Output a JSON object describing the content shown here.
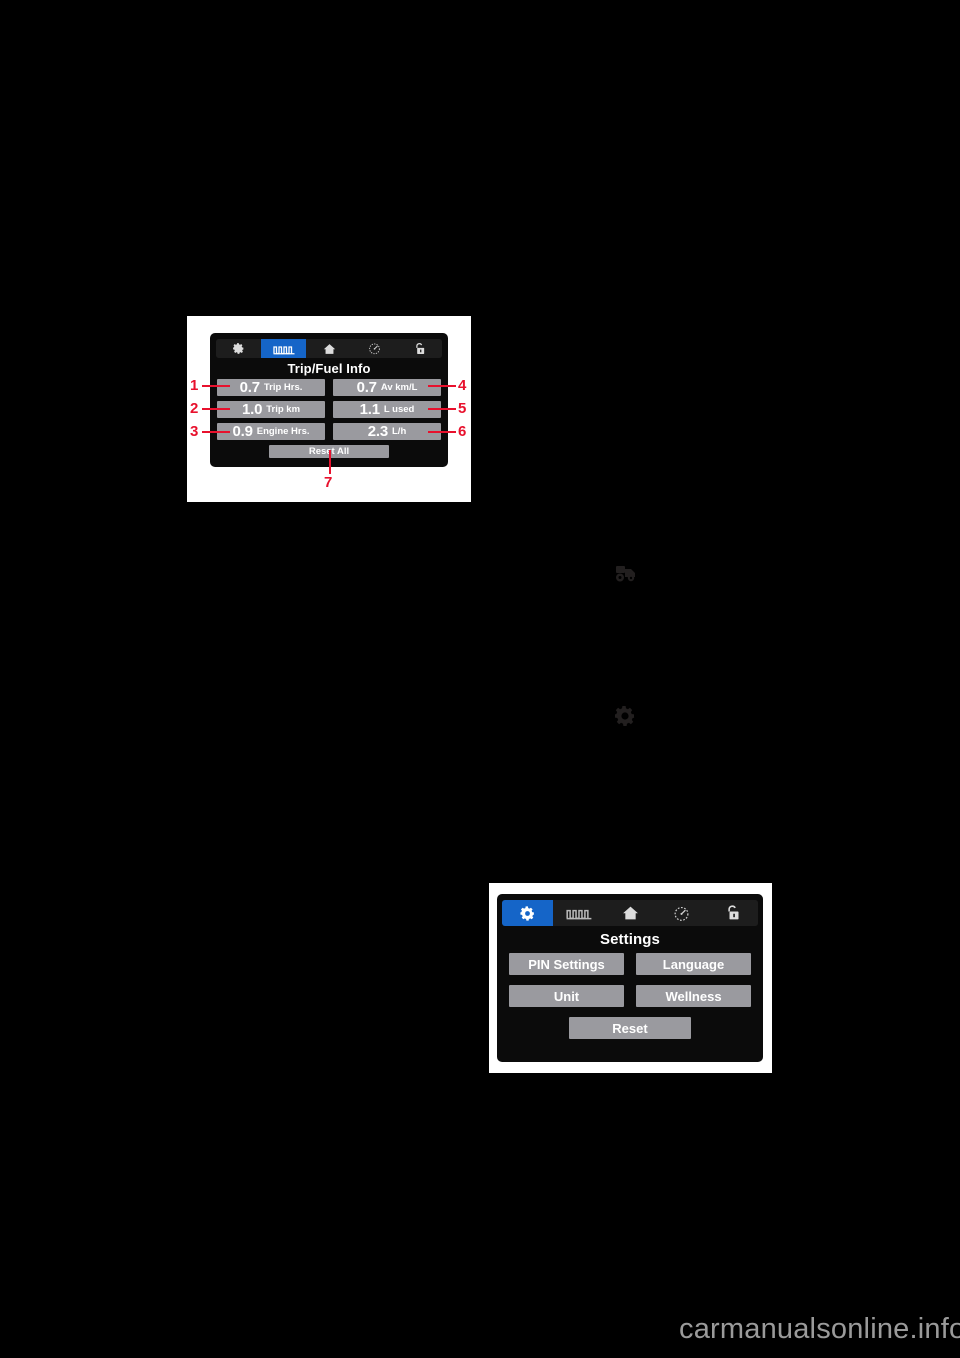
{
  "page": {
    "background_color": "#000000",
    "watermark": "carmanualsonline.info",
    "accent_color": "#1565c8",
    "callout_color": "#e8112d",
    "button_color": "#9a9a9f"
  },
  "figure_trip": {
    "name": "Trip/Fuel Info screen",
    "tabs": [
      {
        "icon": "gear-icon",
        "active": false
      },
      {
        "icon": "trip-meter-icon",
        "active": true
      },
      {
        "icon": "home-icon",
        "active": false
      },
      {
        "icon": "gauge-icon",
        "active": false
      },
      {
        "icon": "unlock-padlock-icon",
        "active": false
      }
    ],
    "title": "Trip/Fuel Info",
    "items": [
      {
        "callout": "1",
        "value": "0.7",
        "unit": "Trip Hrs.",
        "side": "left"
      },
      {
        "callout": "2",
        "value": "1.0",
        "unit": "Trip km",
        "side": "left"
      },
      {
        "callout": "3",
        "value": "0.9",
        "unit": "Engine Hrs.",
        "side": "left"
      },
      {
        "callout": "4",
        "value": "0.7",
        "unit": "Av km/L",
        "side": "right"
      },
      {
        "callout": "5",
        "value": "1.1",
        "unit": "L used",
        "side": "right"
      },
      {
        "callout": "6",
        "value": "2.3",
        "unit": "L/h",
        "side": "right"
      }
    ],
    "reset_all": {
      "callout": "7",
      "label": "Reset All"
    }
  },
  "figure_settings": {
    "name": "Settings screen",
    "tabs": [
      {
        "icon": "gear-icon",
        "active": true
      },
      {
        "icon": "trip-meter-icon",
        "active": false
      },
      {
        "icon": "home-icon",
        "active": false
      },
      {
        "icon": "gauge-icon",
        "active": false
      },
      {
        "icon": "unlock-padlock-icon",
        "active": false
      }
    ],
    "title": "Settings",
    "buttons": [
      {
        "label": "PIN Settings"
      },
      {
        "label": "Language"
      },
      {
        "label": "Unit"
      },
      {
        "label": "Wellness"
      },
      {
        "label": "Reset"
      }
    ]
  },
  "body_icons": [
    {
      "name": "vehicle-icon",
      "label": ""
    },
    {
      "name": "gear-icon",
      "label": ""
    }
  ]
}
